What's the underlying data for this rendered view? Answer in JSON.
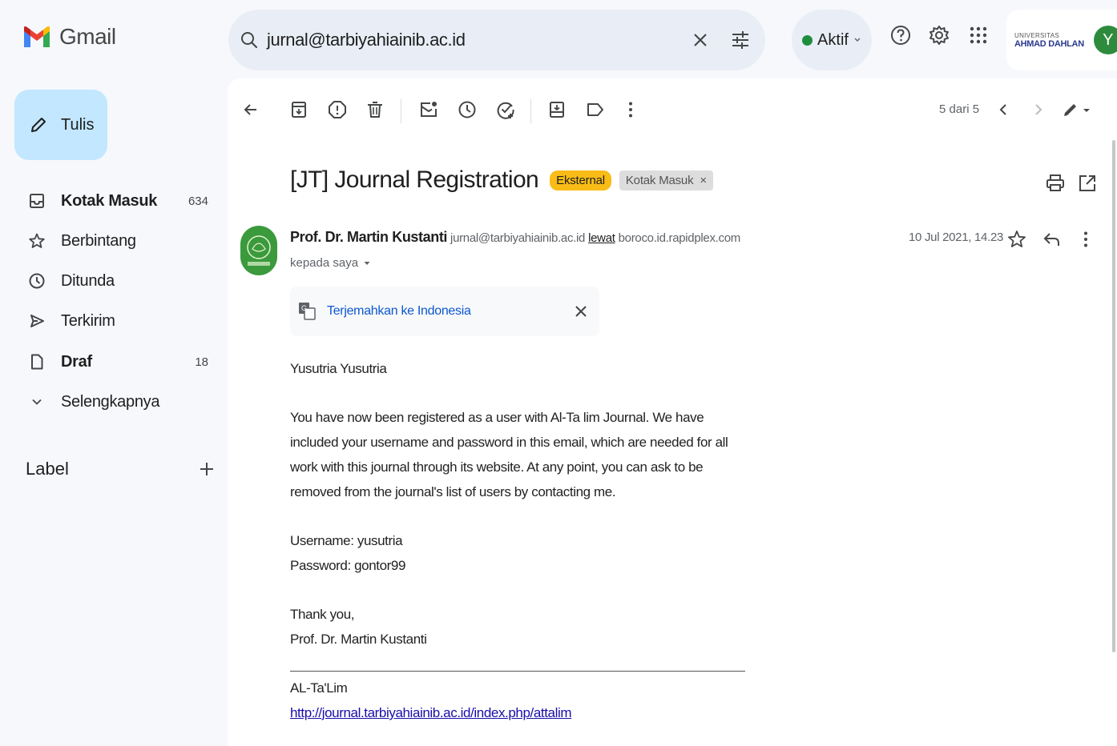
{
  "app": {
    "name": "Gmail"
  },
  "search": {
    "query": "jurnal@tarbiyahiainib.ac.id"
  },
  "header": {
    "status": "Aktif",
    "account": {
      "org_line1": "UNIVERSITAS",
      "org_line2": "AHMAD DAHLAN",
      "avatar_letter": "Y"
    }
  },
  "sidebar": {
    "compose_label": "Tulis",
    "items": [
      {
        "label": "Kotak Masuk",
        "count": "634",
        "icon": "inbox-icon"
      },
      {
        "label": "Berbintang",
        "count": "",
        "icon": "star-icon"
      },
      {
        "label": "Ditunda",
        "count": "",
        "icon": "clock-icon"
      },
      {
        "label": "Terkirim",
        "count": "",
        "icon": "send-icon"
      },
      {
        "label": "Draf",
        "count": "18",
        "icon": "draft-icon"
      },
      {
        "label": "Selengkapnya",
        "count": "",
        "icon": "chevron-down-icon"
      }
    ],
    "label_heading": "Label"
  },
  "toolbar": {
    "pager": "5 dari 5"
  },
  "email": {
    "subject": "[JT] Journal Registration",
    "badge_external": "Eksternal",
    "badge_inbox": "Kotak Masuk",
    "sender_name": "Prof. Dr. Martin Kustanti",
    "sender_email": "jurnal@tarbiyahiainib.ac.id",
    "via_word": "lewat",
    "via_domain": "boroco.id.rapidplex.com",
    "to_line": "kepada saya",
    "date": "10 Jul 2021, 14.23",
    "translate_label": "Terjemahkan ke Indonesia",
    "greeting": "Yusutria Yusutria",
    "para": [
      "You have now been registered as a user with Al-Ta lim Journal. We have",
      "included your username and password in this email, which are needed for all",
      "work with this journal through its website. At any point, you can ask to be",
      "removed from the journal's list of users by contacting me."
    ],
    "username": "Username: yusutria",
    "password": "Password: gontor99",
    "thanks": "Thank you,",
    "signature": "Prof. Dr. Martin Kustanti",
    "footer_org": "AL-Ta'Lim",
    "footer_link": "http://journal.tarbiyahiainib.ac.id/index.php/attalim"
  },
  "colors": {
    "compose_bg": "#c2e7ff",
    "external_badge": "#f9bc16",
    "status_dot": "#1e8e3e",
    "link": "#1a0dab"
  }
}
